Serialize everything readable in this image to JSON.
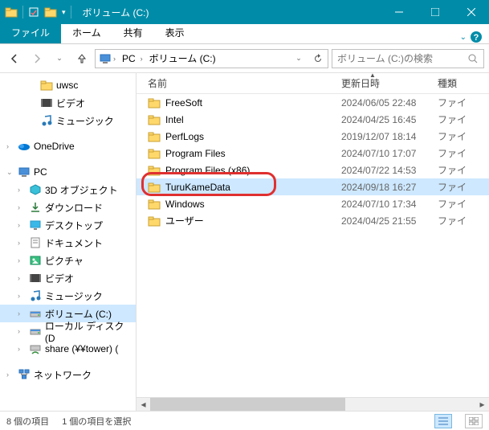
{
  "titlebar": {
    "title": "ボリューム (C:)"
  },
  "ribbon": {
    "file": "ファイル",
    "home": "ホーム",
    "share": "共有",
    "view": "表示"
  },
  "nav": {
    "breadcrumb": [
      "PC",
      "ボリューム (C:)"
    ]
  },
  "search": {
    "placeholder": "ボリューム (C:)の検索"
  },
  "tree": {
    "items": [
      {
        "label": "uwsc",
        "icon": "folder",
        "indent": 1
      },
      {
        "label": "ビデオ",
        "icon": "video",
        "indent": 1
      },
      {
        "label": "ミュージック",
        "icon": "music",
        "indent": 1
      }
    ],
    "onedrive": "OneDrive",
    "pc": {
      "label": "PC",
      "expanded": true
    },
    "pcItems": [
      {
        "label": "3D オブジェクト",
        "icon": "3d"
      },
      {
        "label": "ダウンロード",
        "icon": "download"
      },
      {
        "label": "デスクトップ",
        "icon": "desktop"
      },
      {
        "label": "ドキュメント",
        "icon": "document"
      },
      {
        "label": "ピクチャ",
        "icon": "picture"
      },
      {
        "label": "ビデオ",
        "icon": "video"
      },
      {
        "label": "ミュージック",
        "icon": "music"
      },
      {
        "label": "ボリューム (C:)",
        "icon": "drive",
        "selected": true
      },
      {
        "label": "ローカル ディスク (D",
        "icon": "drive"
      },
      {
        "label": "share (¥¥tower) (",
        "icon": "netdrive"
      }
    ],
    "network": "ネットワーク"
  },
  "columns": {
    "name": "名前",
    "date": "更新日時",
    "type": "種類"
  },
  "rows": [
    {
      "name": "FreeSoft",
      "date": "2024/06/05 22:48",
      "type": "ファイ"
    },
    {
      "name": "Intel",
      "date": "2024/04/25 16:45",
      "type": "ファイ"
    },
    {
      "name": "PerfLogs",
      "date": "2019/12/07 18:14",
      "type": "ファイ"
    },
    {
      "name": "Program Files",
      "date": "2024/07/10 17:07",
      "type": "ファイ"
    },
    {
      "name": "Program Files (x86)",
      "date": "2024/07/22 14:53",
      "type": "ファイ"
    },
    {
      "name": "TuruKameData",
      "date": "2024/09/18 16:27",
      "type": "ファイ",
      "selected": true,
      "highlighted": true
    },
    {
      "name": "Windows",
      "date": "2024/07/10 17:34",
      "type": "ファイ"
    },
    {
      "name": "ユーザー",
      "date": "2024/04/25 21:55",
      "type": "ファイ"
    }
  ],
  "status": {
    "count": "8 個の項目",
    "selection": "1 個の項目を選択"
  }
}
